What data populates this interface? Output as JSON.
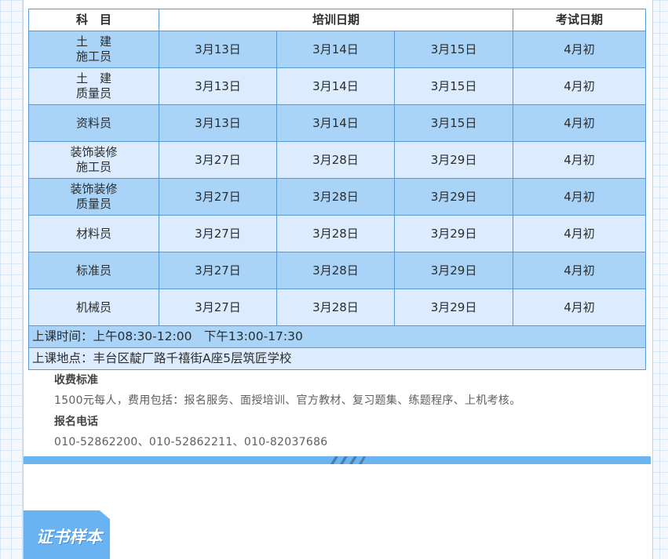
{
  "table": {
    "headers": {
      "subject": "科　目",
      "training": "培训日期",
      "exam": "考试日期"
    },
    "rows": [
      {
        "subject_line1": "土　建",
        "subject_line2": "施工员",
        "d1": "3月13日",
        "d2": "3月14日",
        "d3": "3月15日",
        "exam": "4月初"
      },
      {
        "subject_line1": "土　建",
        "subject_line2": "质量员",
        "d1": "3月13日",
        "d2": "3月14日",
        "d3": "3月15日",
        "exam": "4月初"
      },
      {
        "subject_line1": "资料员",
        "subject_line2": "",
        "d1": "3月13日",
        "d2": "3月14日",
        "d3": "3月15日",
        "exam": "4月初"
      },
      {
        "subject_line1": "装饰装修",
        "subject_line2": "施工员",
        "d1": "3月27日",
        "d2": "3月28日",
        "d3": "3月29日",
        "exam": "4月初"
      },
      {
        "subject_line1": "装饰装修",
        "subject_line2": "质量员",
        "d1": "3月27日",
        "d2": "3月28日",
        "d3": "3月29日",
        "exam": "4月初"
      },
      {
        "subject_line1": "材料员",
        "subject_line2": "",
        "d1": "3月27日",
        "d2": "3月28日",
        "d3": "3月29日",
        "exam": "4月初"
      },
      {
        "subject_line1": "标准员",
        "subject_line2": "",
        "d1": "3月27日",
        "d2": "3月28日",
        "d3": "3月29日",
        "exam": "4月初"
      },
      {
        "subject_line1": "机械员",
        "subject_line2": "",
        "d1": "3月27日",
        "d2": "3月28日",
        "d3": "3月29日",
        "exam": "4月初"
      }
    ],
    "class_time": "上课时间：上午08:30-12:00　下午13:00-17:30",
    "class_location": "上课地点：丰台区靛厂路千禧街A座5层筑匠学校"
  },
  "fees": {
    "heading": "收费标准",
    "text": "1500元每人，费用包括：报名服务、面授培训、官方教材、复习题集、练题程序、上机考核。"
  },
  "signup": {
    "heading": "报名电话",
    "phones": "010-52862200、010-52862211、010-82037686"
  },
  "section_tab": {
    "title": "证书样本"
  },
  "colors": {
    "accent": "#6cb4f1",
    "row_dark": "#a9d4f7",
    "row_light": "#dcebfd",
    "border": "#5b9bd5"
  }
}
